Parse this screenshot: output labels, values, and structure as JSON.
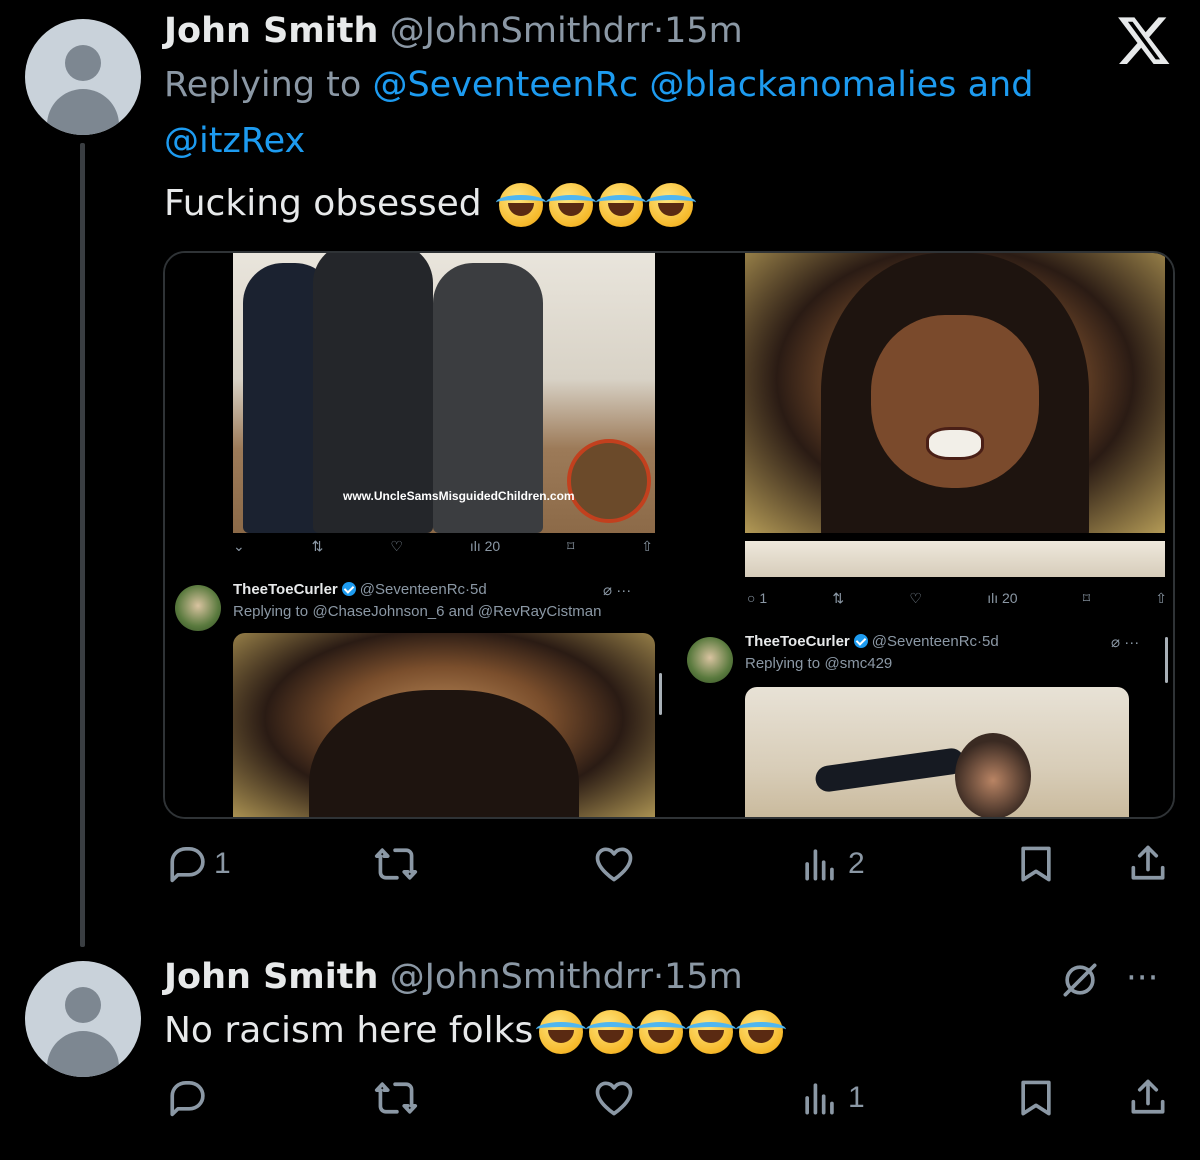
{
  "tweet1": {
    "name": "John Smith",
    "handle": "@JohnSmithdrr",
    "dot": "·",
    "time": "15m",
    "replying_prefix": "Replying to",
    "mention1": "@SeventeenRc",
    "mention2": "@blackanomalies",
    "and": "and",
    "mention3": "@itzRex",
    "text": "Fucking obsessed",
    "emoji_count": 4,
    "media": {
      "left": {
        "watermark": "www.UncleSamsMisguidedChildren.com",
        "stats": "20",
        "quoted": {
          "name": "TheeToeCurler",
          "handle": "@SeventeenRc",
          "dot": "·",
          "time": "5d",
          "more": "···",
          "replying_prefix": "Replying to",
          "mentions": "@ChaseJohnson_6 and @RevRayCistman"
        }
      },
      "right": {
        "stats": {
          "replies": "1",
          "views": "20"
        },
        "quoted": {
          "name": "TheeToeCurler",
          "handle": "@SeventeenRc",
          "dot": "·",
          "time": "5d",
          "more": "···",
          "replying_prefix": "Replying to",
          "mentions": "@smc429"
        }
      }
    },
    "actions": {
      "replies": "1",
      "views": "2"
    }
  },
  "tweet2": {
    "name": "John Smith",
    "handle": "@JohnSmithdrr",
    "dot": "·",
    "time": "15m",
    "more": "···",
    "text": "No racism here folks",
    "emoji_count": 5,
    "actions": {
      "views": "1"
    }
  },
  "colors": {
    "background": "#000000",
    "text": "#e7e9ea",
    "muted": "#8b98a5",
    "link": "#1d9bf0"
  },
  "icons": [
    "x-logo-icon",
    "reply-icon",
    "retweet-icon",
    "like-icon",
    "views-icon",
    "bookmark-icon",
    "share-icon",
    "grok-icon",
    "more-icon",
    "verified-icon",
    "laughing-emoji-icon"
  ]
}
